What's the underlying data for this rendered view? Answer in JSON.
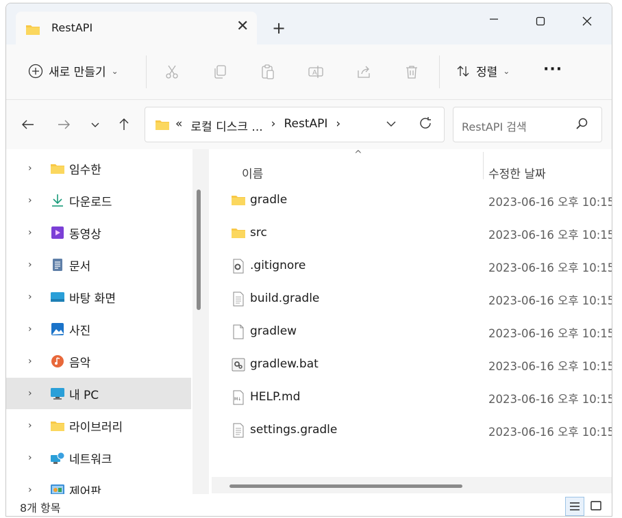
{
  "tab": {
    "title": "RestAPI"
  },
  "toolbar": {
    "new_label": "새로 만들기",
    "sort_label": "정렬"
  },
  "address": {
    "seg1": "«",
    "seg2": "로컬 디스크 ...",
    "seg3": "›",
    "seg4": "RestAPI",
    "seg5": "›"
  },
  "search": {
    "placeholder": "RestAPI 검색"
  },
  "nav": {
    "items": [
      {
        "label": "임수한",
        "icon": "folder-icon"
      },
      {
        "label": "다운로드",
        "icon": "download-icon"
      },
      {
        "label": "동영상",
        "icon": "video-icon"
      },
      {
        "label": "문서",
        "icon": "document-icon"
      },
      {
        "label": "바탕 화면",
        "icon": "desktop-icon"
      },
      {
        "label": "사진",
        "icon": "pictures-icon"
      },
      {
        "label": "음악",
        "icon": "music-icon"
      },
      {
        "label": "내 PC",
        "icon": "pc-icon"
      },
      {
        "label": "라이브러리",
        "icon": "library-icon"
      },
      {
        "label": "네트워크",
        "icon": "network-icon"
      },
      {
        "label": "제어판",
        "icon": "control-panel-icon"
      }
    ]
  },
  "columns": {
    "name": "이름",
    "date": "수정한 날짜"
  },
  "files": [
    {
      "name": "gradle",
      "date": "2023-06-16 오후 10:15",
      "icon": "folder-icon"
    },
    {
      "name": "src",
      "date": "2023-06-16 오후 10:15",
      "icon": "folder-icon"
    },
    {
      "name": ".gitignore",
      "date": "2023-06-16 오후 10:15",
      "icon": "config-file-icon"
    },
    {
      "name": "build.gradle",
      "date": "2023-06-16 오후 10:15",
      "icon": "text-file-icon"
    },
    {
      "name": "gradlew",
      "date": "2023-06-16 오후 10:15",
      "icon": "blank-file-icon"
    },
    {
      "name": "gradlew.bat",
      "date": "2023-06-16 오후 10:15",
      "icon": "batch-file-icon"
    },
    {
      "name": "HELP.md",
      "date": "2023-06-16 오후 10:15",
      "icon": "markdown-file-icon"
    },
    {
      "name": "settings.gradle",
      "date": "2023-06-16 오후 10:15",
      "icon": "text-file-icon"
    }
  ],
  "status": {
    "count": "8개 항목"
  },
  "colors": {
    "folder": "#f8c846",
    "selected_bg": "#e5e5e5",
    "titlebar_bg": "#eff3f8"
  }
}
